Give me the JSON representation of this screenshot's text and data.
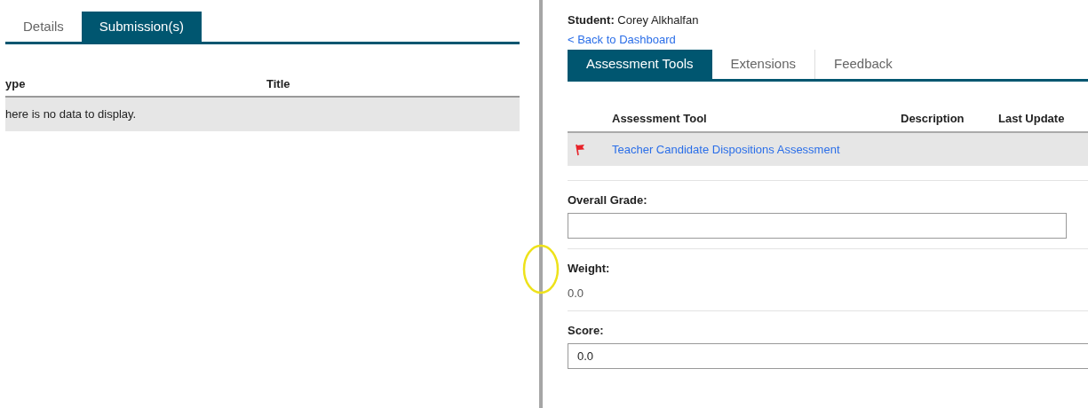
{
  "left_pane": {
    "tabs": [
      {
        "label": "Details",
        "selected": false
      },
      {
        "label": "Submission(s)",
        "selected": true
      }
    ],
    "table": {
      "columns": [
        "ype",
        "Title"
      ],
      "empty_message": "here is no data to display."
    }
  },
  "right_pane": {
    "student": {
      "label": "Student:",
      "name": "Corey Alkhalfan"
    },
    "back_link": "< Back to Dashboard",
    "tabs": [
      {
        "label": "Assessment Tools",
        "selected": true
      },
      {
        "label": "Extensions",
        "selected": false
      },
      {
        "label": "Feedback",
        "selected": false
      }
    ],
    "table": {
      "columns": [
        "Assessment Tool",
        "Description",
        "Last Update"
      ],
      "rows": [
        {
          "flagged": true,
          "title": "Teacher Candidate Dispositions Assessment"
        }
      ]
    },
    "fields": [
      {
        "kind": "input",
        "label": "Overall Grade:"
      },
      {
        "kind": "text",
        "label": "Weight:",
        "value": "0.0"
      },
      {
        "kind": "input",
        "label": "Score:",
        "value": "0.0"
      }
    ]
  }
}
